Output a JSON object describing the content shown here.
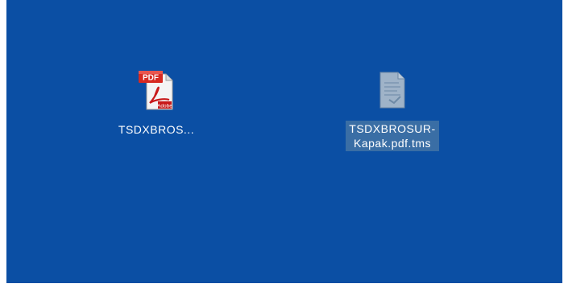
{
  "desktop": {
    "background_color": "#0b4fa4",
    "icons": [
      {
        "label": "TSDXBROS...",
        "icon": "pdf-document-icon",
        "badge": "PDF",
        "brand": "Adobe",
        "selected": false
      },
      {
        "label_line1": "TSDXBROSUR-",
        "label_line2": "Kapak.pdf.tms",
        "icon": "generic-file-icon",
        "selected": true,
        "selection_color": "#3a6ea5"
      }
    ]
  }
}
